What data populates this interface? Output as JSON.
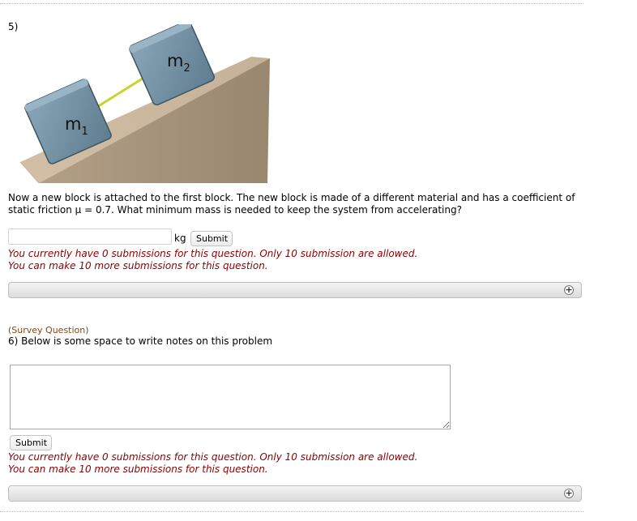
{
  "question5": {
    "number": "5)",
    "figure": {
      "block1_label": "m",
      "block1_sub": "1",
      "block2_label": "m",
      "block2_sub": "2"
    },
    "text": "Now a new block is attached to the first block. The new block is made of a different material and has a coefficient of static friction μ = 0.7. What minimum mass is needed to keep the system from accelerating?",
    "answer_value": "",
    "unit": "kg",
    "submit_label": "Submit",
    "status_line1": "You currently have 0 submissions for this question. Only 10 submission are allowed.",
    "status_line2": "You can make 10 more submissions for this question.",
    "expand_icon": "plus-circle-icon"
  },
  "question6": {
    "tag": "(Survey Question)",
    "text": "6) Below is some space to write notes on this problem",
    "notes_value": "",
    "submit_label": "Submit",
    "status_line1": "You currently have 0 submissions for this question. Only 10 submission are allowed.",
    "status_line2": "You can make 10 more submissions for this question.",
    "expand_icon": "plus-circle-icon"
  },
  "colors": {
    "status_text": "#8b0000",
    "survey_tag": "#8b4513",
    "ramp": "#b8a58e",
    "block": "#6f8fa3",
    "rope": "#c8d42a"
  }
}
